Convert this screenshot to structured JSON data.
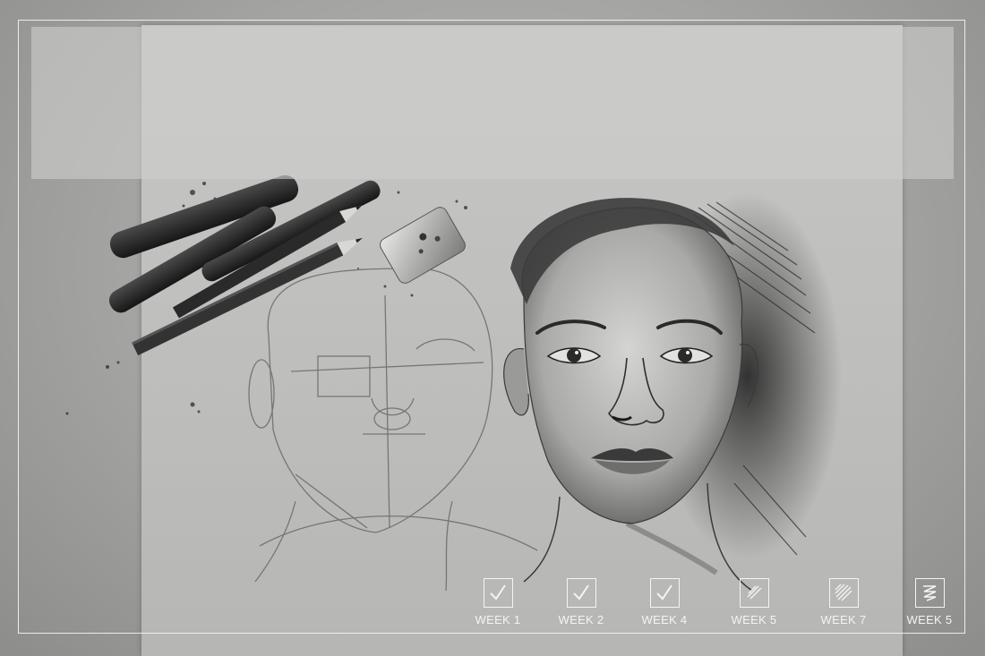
{
  "progress": {
    "weeks": [
      {
        "label": "WEEK 1",
        "icon": "checkmark-icon"
      },
      {
        "label": "WEEK 2",
        "icon": "checkmark-icon"
      },
      {
        "label": "WEEK 4",
        "icon": "checkmark-icon"
      },
      {
        "label": "WEEK 5",
        "icon": "light-hatch-icon"
      },
      {
        "label": "WEEK 7",
        "icon": "dense-hatch-icon"
      },
      {
        "label": "WEEK 5",
        "icon": "scribble-icon"
      }
    ]
  },
  "colors": {
    "frame": "#f4f4f4",
    "paper": "#c2c2c0",
    "charcoal": "#2a2a2a"
  }
}
